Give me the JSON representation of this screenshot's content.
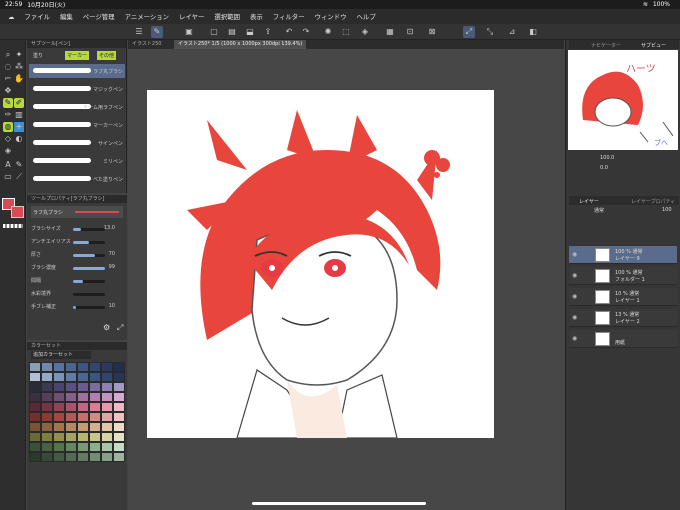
{
  "status": {
    "time": "22:59",
    "date": "10月20日(火)",
    "battery": "100%"
  },
  "menu": [
    "ファイル",
    "編集",
    "ページ管理",
    "アニメーション",
    "レイヤー",
    "選択範囲",
    "表示",
    "フィルター",
    "ウィンドウ",
    "ヘルプ"
  ],
  "subtool": {
    "header": "サブツール[ペン]",
    "tabs": [
      "塗り",
      "マーカー",
      "その他"
    ],
    "brushes": [
      "ラフ丸ブラシ",
      "マジックペン",
      "チーム用ラフペン",
      "マーカーペン",
      "サインペン",
      "ミリペン",
      "べた塗りペン"
    ]
  },
  "toolprop": {
    "header": "ツールプロパティ[ラフ丸ブラシ]",
    "brushname": "ラフ丸ブラシ",
    "rows": [
      {
        "label": "ブラシサイズ",
        "value": "13.0",
        "level": 0.25
      },
      {
        "label": "アンチエイリアス",
        "value": "",
        "level": 0.5
      },
      {
        "label": "厚さ",
        "value": "70",
        "level": 0.7
      },
      {
        "label": "ブラシ濃度",
        "value": "99",
        "level": 0.99
      },
      {
        "label": "間隔",
        "value": "",
        "level": 0.3
      },
      {
        "label": "水彩境界",
        "value": "",
        "level": 0
      },
      {
        "label": "手ブレ補正",
        "value": "10",
        "level": 0.1
      }
    ]
  },
  "colorset": {
    "header": "カラーセット",
    "selector": "追加カラーセット"
  },
  "swatches": [
    "#8a9fb8",
    "#6f88ab",
    "#5673a0",
    "#4a6592",
    "#3d5582",
    "#314670",
    "#2a3a5e",
    "#20304e",
    "#b2c0d6",
    "#96a9c6",
    "#7a93b6",
    "#5f7ca5",
    "#4b6893",
    "#3b567f",
    "#2e466b",
    "#233857",
    "#2a2a3a",
    "#3a3a55",
    "#4a4470",
    "#5c4f86",
    "#6c5a92",
    "#7c6aa0",
    "#8f80b4",
    "#a698c6",
    "#3a2f40",
    "#53405a",
    "#6d5074",
    "#86608c",
    "#9e6f9f",
    "#b27fb0",
    "#c493c2",
    "#d6a8d4",
    "#5a2838",
    "#763447",
    "#934258",
    "#ad526b",
    "#c3667f",
    "#d67f95",
    "#e59aac",
    "#f0b8c6",
    "#7a2d2d",
    "#923636",
    "#a84444",
    "#bb5656",
    "#c96c6c",
    "#d68787",
    "#e2a4a4",
    "#edc3c3",
    "#7a5234",
    "#8e623f",
    "#a3744d",
    "#b5875e",
    "#c69b73",
    "#d4b08c",
    "#e2c6a7",
    "#efdcc5",
    "#6b6a36",
    "#7e7d42",
    "#929050",
    "#a5a462",
    "#b6b676",
    "#c6c68d",
    "#d5d5a6",
    "#e4e4c3",
    "#3a5234",
    "#46623f",
    "#54744d",
    "#65875e",
    "#779b73",
    "#8cb08c",
    "#a6c6a7",
    "#c5dcc5",
    "#2a3a2a",
    "#374a37",
    "#445a44",
    "#536a53",
    "#637a63",
    "#748c74",
    "#889e88",
    "#9fb29f"
  ],
  "canvas": {
    "tabs": [
      "イラスト250",
      "イラスト250* 1/5 (1000 x 1000px 300dpi 139.4%)"
    ]
  },
  "nav": {
    "tabs": [
      "ナビゲーター",
      "サブビュー"
    ],
    "zoom": "100.0",
    "angle": "0.0"
  },
  "layerpanel": {
    "tabs": [
      "レイヤー",
      "レイヤープロパティ"
    ],
    "blend": "通常",
    "opacity": "100"
  },
  "layers": [
    {
      "l1": "100 % 通常",
      "l2": "レイヤー 9",
      "active": true
    },
    {
      "l1": "100 % 通常",
      "l2": "フォルダー 1",
      "active": false
    },
    {
      "l1": "10 % 通常",
      "l2": "レイヤー 1",
      "active": false
    },
    {
      "l1": "13 % 通常",
      "l2": "レイヤー 2",
      "active": false
    },
    {
      "l1": "",
      "l2": "用紙",
      "active": false
    }
  ],
  "colors": {
    "hair": "#e8453c",
    "accent": "#b7d93c",
    "main": "#d94a52"
  },
  "thumb": {
    "text1": "ハーツ",
    "text2": "ブヘ"
  }
}
